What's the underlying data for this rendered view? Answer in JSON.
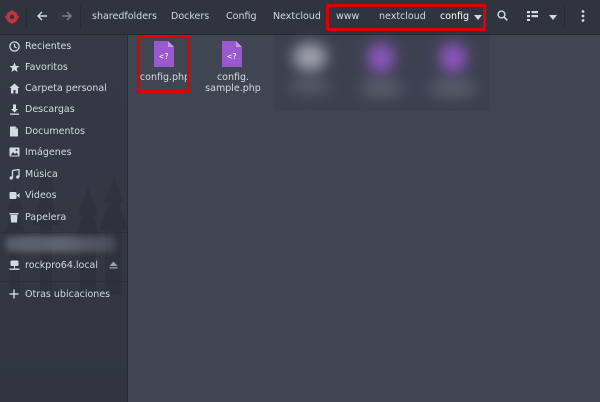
{
  "header": {
    "app_icon": "app-menu-icon",
    "back_icon": "arrow-left-icon",
    "forward_icon": "arrow-right-icon",
    "breadcrumbs": [
      "sharedfolders",
      "Dockers",
      "Config",
      "Nextcloud",
      "www",
      "nextcloud",
      "config"
    ],
    "breadcrumb_dropdown_icon": "caret-down-icon",
    "search_icon": "search-icon",
    "view_icon": "list-view-icon",
    "view_dropdown_icon": "caret-down-icon",
    "menu_icon": "kebab-menu-icon"
  },
  "sidebar": {
    "places": [
      {
        "label": "Recientes",
        "icon": "clock-icon"
      },
      {
        "label": "Favoritos",
        "icon": "star-icon"
      },
      {
        "label": "Carpeta personal",
        "icon": "home-icon"
      },
      {
        "label": "Descargas",
        "icon": "download-icon"
      },
      {
        "label": "Documentos",
        "icon": "document-icon"
      },
      {
        "label": "Imágenes",
        "icon": "image-icon"
      },
      {
        "label": "Música",
        "icon": "music-icon"
      },
      {
        "label": "Videos",
        "icon": "video-icon"
      },
      {
        "label": "Papelera",
        "icon": "trash-icon"
      }
    ],
    "devices": [
      {
        "label": "rockpro64.local",
        "icon": "network-drive-icon",
        "action_icon": "eject-icon"
      }
    ],
    "other": {
      "label": "Otras ubicaciones",
      "icon": "plus-icon"
    }
  },
  "files": [
    {
      "name": "config.php",
      "icon": "php-file-icon",
      "highlighted": true
    },
    {
      "name": "config.\nsample.php",
      "icon": "php-file-icon",
      "highlighted": false
    }
  ],
  "colors": {
    "background": "#404552",
    "headerbar": "#2f343f",
    "sidebar": "#353945",
    "text": "#d3dae3",
    "file_icon": "#9b59d0",
    "highlight_frame": "#e10000"
  }
}
